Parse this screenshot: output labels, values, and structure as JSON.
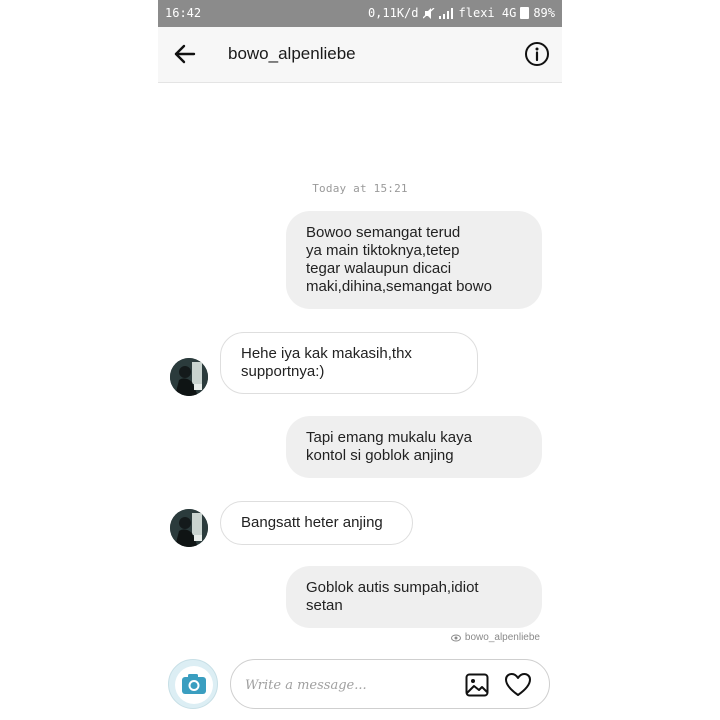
{
  "status_bar": {
    "time": "16:42",
    "network_speed": "0,11K/d",
    "carrier": "flexi 4G",
    "battery": "89%"
  },
  "header": {
    "title": "bowo_alpenliebe",
    "back_icon": "arrow-left-icon",
    "info_icon": "info-circle-icon"
  },
  "thread": {
    "date_separator": "Today at 15:21",
    "messages": [
      {
        "direction": "outgoing",
        "lines": [
          "Bowoo semangat terud",
          "ya main tiktoknya,tetep",
          "tegar walaupun dicaci",
          "maki,dihina,semangat bowo"
        ]
      },
      {
        "direction": "incoming",
        "lines": [
          "Hehe iya kak makasih,thx",
          "supportnya:)"
        ]
      },
      {
        "direction": "outgoing",
        "lines": [
          "Tapi emang mukalu kaya",
          "kontol si goblok anjing"
        ]
      },
      {
        "direction": "incoming",
        "lines": [
          "Bangsatt heter anjing"
        ]
      },
      {
        "direction": "outgoing",
        "lines": [
          "Goblok autis sumpah,idiot",
          "setan"
        ]
      }
    ],
    "seen_by": "bowo_alpenliebe"
  },
  "composer": {
    "placeholder": "Write a message...",
    "camera_icon": "camera-icon",
    "gallery_icon": "image-icon",
    "heart_icon": "heart-icon"
  },
  "colors": {
    "status_bar": "#8b8b8b",
    "header_bg": "#f7f7f7",
    "outgoing_bubble": "#efefef",
    "incoming_bubble_border": "#dedede",
    "camera_button": "#3a9ec0"
  }
}
